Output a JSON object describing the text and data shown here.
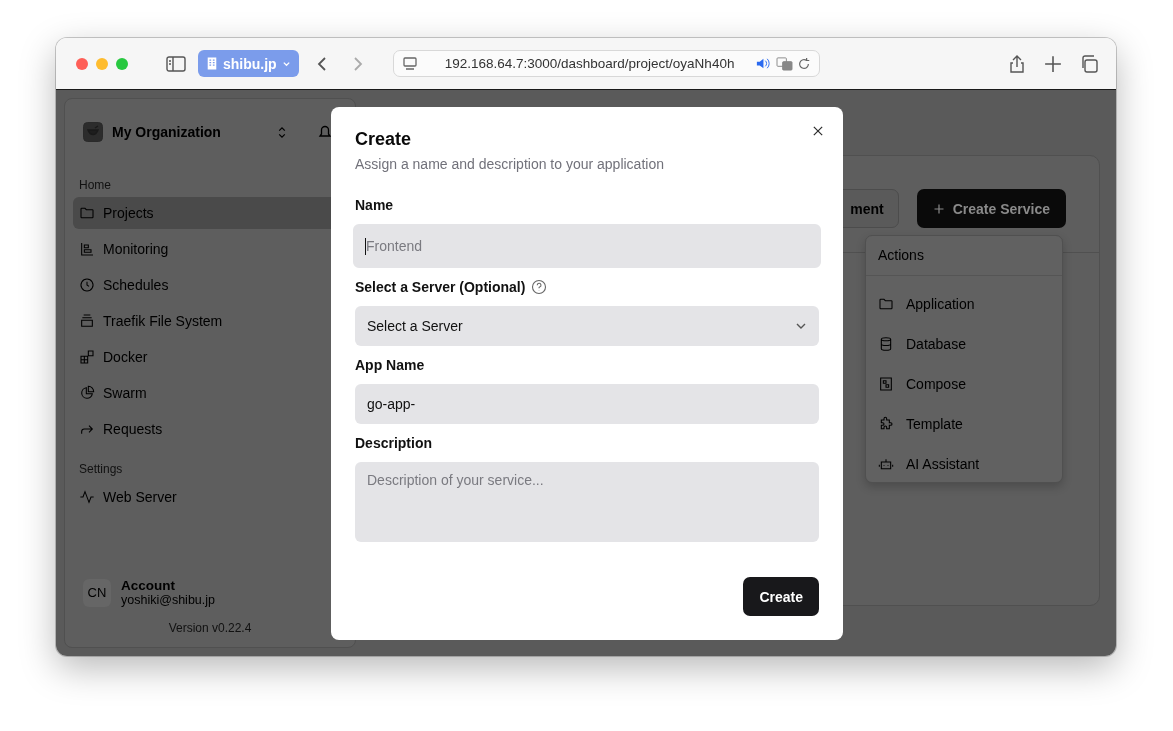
{
  "browser": {
    "tab_group": "shibu.jp",
    "url": "192.168.64.7:3000/dashboard/project/oyaNh40h"
  },
  "sidebar": {
    "organization": "My Organization",
    "sections": [
      {
        "label": "Home",
        "items": [
          {
            "label": "Projects",
            "selected": true
          },
          {
            "label": "Monitoring",
            "selected": false
          },
          {
            "label": "Schedules",
            "selected": false
          },
          {
            "label": "Traefik File System",
            "selected": false
          },
          {
            "label": "Docker",
            "selected": false
          },
          {
            "label": "Swarm",
            "selected": false
          },
          {
            "label": "Requests",
            "selected": false
          }
        ]
      },
      {
        "label": "Settings",
        "items": [
          {
            "label": "Web Server",
            "selected": false
          }
        ]
      }
    ],
    "account": {
      "initials": "CN",
      "name": "Account",
      "email": "yoshiki@shibu.jp"
    },
    "version": "Version v0.22.4"
  },
  "main": {
    "secondary_button": "ment",
    "create_button": "Create Service",
    "actions_menu": {
      "title": "Actions",
      "items": [
        "Application",
        "Database",
        "Compose",
        "Template",
        "AI Assistant"
      ]
    }
  },
  "dialog": {
    "title": "Create",
    "subtitle": "Assign a name and description to your application",
    "fields": [
      {
        "kind": "input",
        "label": "Name",
        "placeholder": "Frontend",
        "focused": true,
        "help": false
      },
      {
        "kind": "select",
        "label": "Select a Server (Optional)",
        "value": "Select a Server",
        "focused": false,
        "help": true
      },
      {
        "kind": "input",
        "label": "App Name",
        "value": "go-app-",
        "focused": false,
        "help": false
      },
      {
        "kind": "textarea",
        "label": "Description",
        "placeholder": "Description of your service...",
        "focused": false,
        "help": false
      }
    ],
    "submit": "Create"
  }
}
